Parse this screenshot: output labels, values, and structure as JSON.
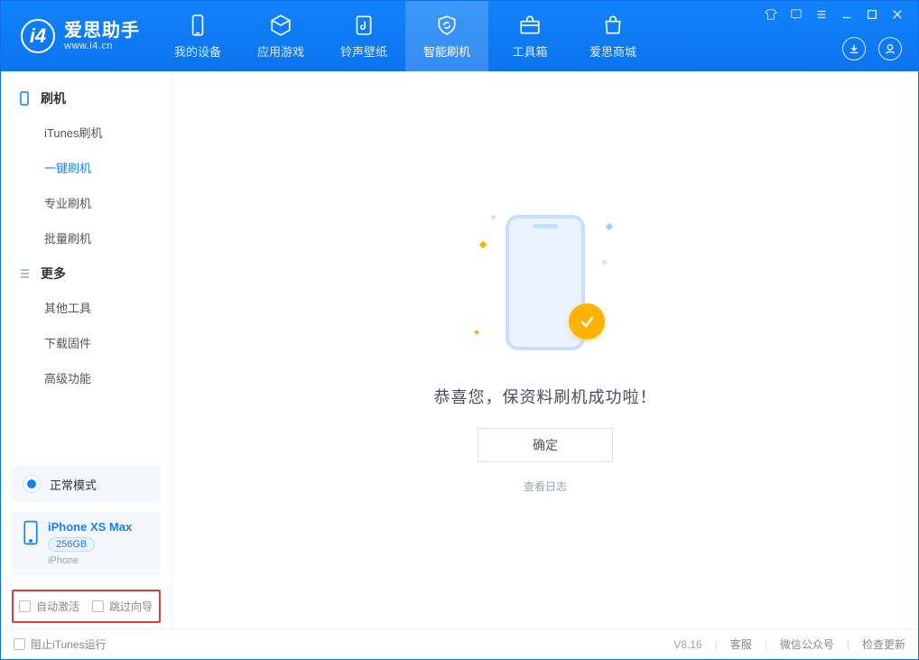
{
  "app": {
    "name": "爱思助手",
    "site": "www.i4.cn"
  },
  "tabs": [
    {
      "id": "device",
      "label": "我的设备"
    },
    {
      "id": "apps",
      "label": "应用游戏"
    },
    {
      "id": "ring",
      "label": "铃声壁纸"
    },
    {
      "id": "flash",
      "label": "智能刷机"
    },
    {
      "id": "tools",
      "label": "工具箱"
    },
    {
      "id": "store",
      "label": "爱思商城"
    }
  ],
  "active_tab": "flash",
  "sidebar": {
    "groups": [
      {
        "title": "刷机",
        "items": [
          {
            "id": "itunes",
            "label": "iTunes刷机"
          },
          {
            "id": "onekey",
            "label": "一键刷机"
          },
          {
            "id": "pro",
            "label": "专业刷机"
          },
          {
            "id": "batch",
            "label": "批量刷机"
          }
        ]
      },
      {
        "title": "更多",
        "items": [
          {
            "id": "other",
            "label": "其他工具"
          },
          {
            "id": "fw",
            "label": "下载固件"
          },
          {
            "id": "adv",
            "label": "高级功能"
          }
        ]
      }
    ],
    "active_item": "onekey"
  },
  "device": {
    "mode": "正常模式",
    "name": "iPhone XS Max",
    "capacity": "256GB",
    "type": "iPhone"
  },
  "options": {
    "auto_activate": {
      "label": "自动激活",
      "checked": false
    },
    "skip_guide": {
      "label": "跳过向导",
      "checked": false
    }
  },
  "main": {
    "success_text": "恭喜您，保资料刷机成功啦！",
    "ok_button": "确定",
    "view_log": "查看日志"
  },
  "footer": {
    "block_itunes": {
      "label": "阻止iTunes运行",
      "checked": false
    },
    "version": "V8.16",
    "links": [
      "客服",
      "微信公众号",
      "检查更新"
    ]
  }
}
